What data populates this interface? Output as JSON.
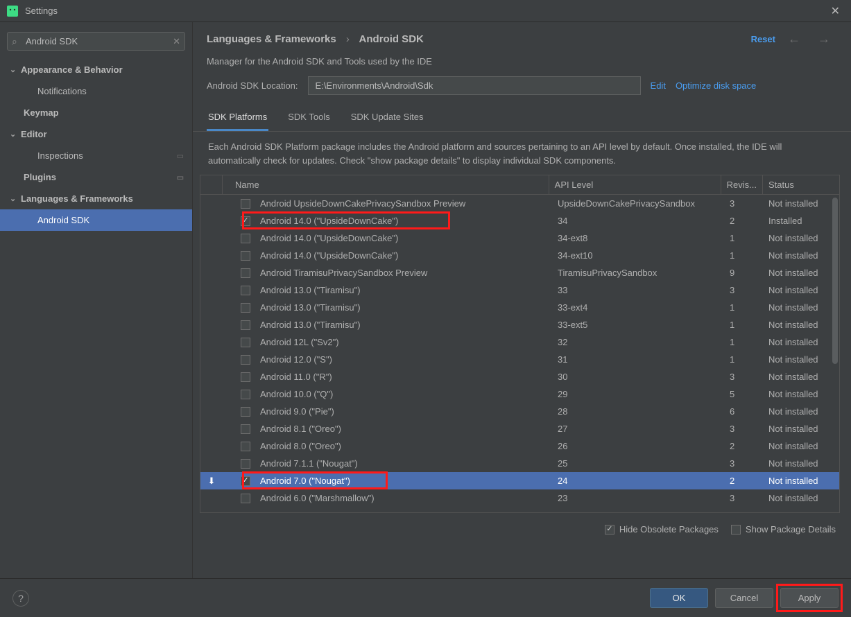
{
  "window": {
    "title": "Settings"
  },
  "search": {
    "value": "Android SDK"
  },
  "sidebar": {
    "items": [
      {
        "label": "Appearance & Behavior",
        "kind": "group"
      },
      {
        "label": "Notifications",
        "kind": "sub"
      },
      {
        "label": "Keymap",
        "kind": "bold"
      },
      {
        "label": "Editor",
        "kind": "group"
      },
      {
        "label": "Inspections",
        "kind": "sub",
        "pin": true
      },
      {
        "label": "Plugins",
        "kind": "bold",
        "pin": true
      },
      {
        "label": "Languages & Frameworks",
        "kind": "group"
      },
      {
        "label": "Android SDK",
        "kind": "sub",
        "selected": true
      }
    ]
  },
  "breadcrumb": {
    "part1": "Languages & Frameworks",
    "part2": "Android SDK"
  },
  "reset": "Reset",
  "desc": "Manager for the Android SDK and Tools used by the IDE",
  "location": {
    "label": "Android SDK Location:",
    "value": "E:\\Environments\\Android\\Sdk",
    "edit": "Edit",
    "optimize": "Optimize disk space"
  },
  "tabs": [
    {
      "label": "SDK Platforms",
      "active": true
    },
    {
      "label": "SDK Tools"
    },
    {
      "label": "SDK Update Sites"
    }
  ],
  "tabDesc": "Each Android SDK Platform package includes the Android platform and sources pertaining to an API level by default. Once installed, the IDE will automatically check for updates. Check \"show package details\" to display individual SDK components.",
  "columns": {
    "name": "Name",
    "api": "API Level",
    "rev": "Revis...",
    "status": "Status"
  },
  "rows": [
    {
      "checked": false,
      "name": "Android UpsideDownCakePrivacySandbox Preview",
      "api": "UpsideDownCakePrivacySandbox",
      "rev": "3",
      "status": "Not installed"
    },
    {
      "checked": true,
      "name": "Android 14.0 (\"UpsideDownCake\")",
      "api": "34",
      "rev": "2",
      "status": "Installed",
      "highlight": true
    },
    {
      "checked": false,
      "name": "Android 14.0 (\"UpsideDownCake\")",
      "api": "34-ext8",
      "rev": "1",
      "status": "Not installed"
    },
    {
      "checked": false,
      "name": "Android 14.0 (\"UpsideDownCake\")",
      "api": "34-ext10",
      "rev": "1",
      "status": "Not installed"
    },
    {
      "checked": false,
      "name": "Android TiramisuPrivacySandbox Preview",
      "api": "TiramisuPrivacySandbox",
      "rev": "9",
      "status": "Not installed"
    },
    {
      "checked": false,
      "name": "Android 13.0 (\"Tiramisu\")",
      "api": "33",
      "rev": "3",
      "status": "Not installed"
    },
    {
      "checked": false,
      "name": "Android 13.0 (\"Tiramisu\")",
      "api": "33-ext4",
      "rev": "1",
      "status": "Not installed"
    },
    {
      "checked": false,
      "name": "Android 13.0 (\"Tiramisu\")",
      "api": "33-ext5",
      "rev": "1",
      "status": "Not installed"
    },
    {
      "checked": false,
      "name": "Android 12L (\"Sv2\")",
      "api": "32",
      "rev": "1",
      "status": "Not installed"
    },
    {
      "checked": false,
      "name": "Android 12.0 (\"S\")",
      "api": "31",
      "rev": "1",
      "status": "Not installed"
    },
    {
      "checked": false,
      "name": "Android 11.0 (\"R\")",
      "api": "30",
      "rev": "3",
      "status": "Not installed"
    },
    {
      "checked": false,
      "name": "Android 10.0 (\"Q\")",
      "api": "29",
      "rev": "5",
      "status": "Not installed"
    },
    {
      "checked": false,
      "name": "Android 9.0 (\"Pie\")",
      "api": "28",
      "rev": "6",
      "status": "Not installed"
    },
    {
      "checked": false,
      "name": "Android 8.1 (\"Oreo\")",
      "api": "27",
      "rev": "3",
      "status": "Not installed"
    },
    {
      "checked": false,
      "name": "Android 8.0 (\"Oreo\")",
      "api": "26",
      "rev": "2",
      "status": "Not installed"
    },
    {
      "checked": false,
      "name": "Android 7.1.1 (\"Nougat\")",
      "api": "25",
      "rev": "3",
      "status": "Not installed"
    },
    {
      "checked": true,
      "name": "Android 7.0 (\"Nougat\")",
      "api": "24",
      "rev": "2",
      "status": "Not installed",
      "selected": true,
      "download": true,
      "highlight": true
    },
    {
      "checked": false,
      "name": "Android 6.0 (\"Marshmallow\")",
      "api": "23",
      "rev": "3",
      "status": "Not installed"
    }
  ],
  "bottomOptions": {
    "hideObsolete": {
      "label": "Hide Obsolete Packages",
      "checked": true
    },
    "showDetails": {
      "label": "Show Package Details",
      "checked": false
    }
  },
  "footer": {
    "ok": "OK",
    "cancel": "Cancel",
    "apply": "Apply"
  }
}
